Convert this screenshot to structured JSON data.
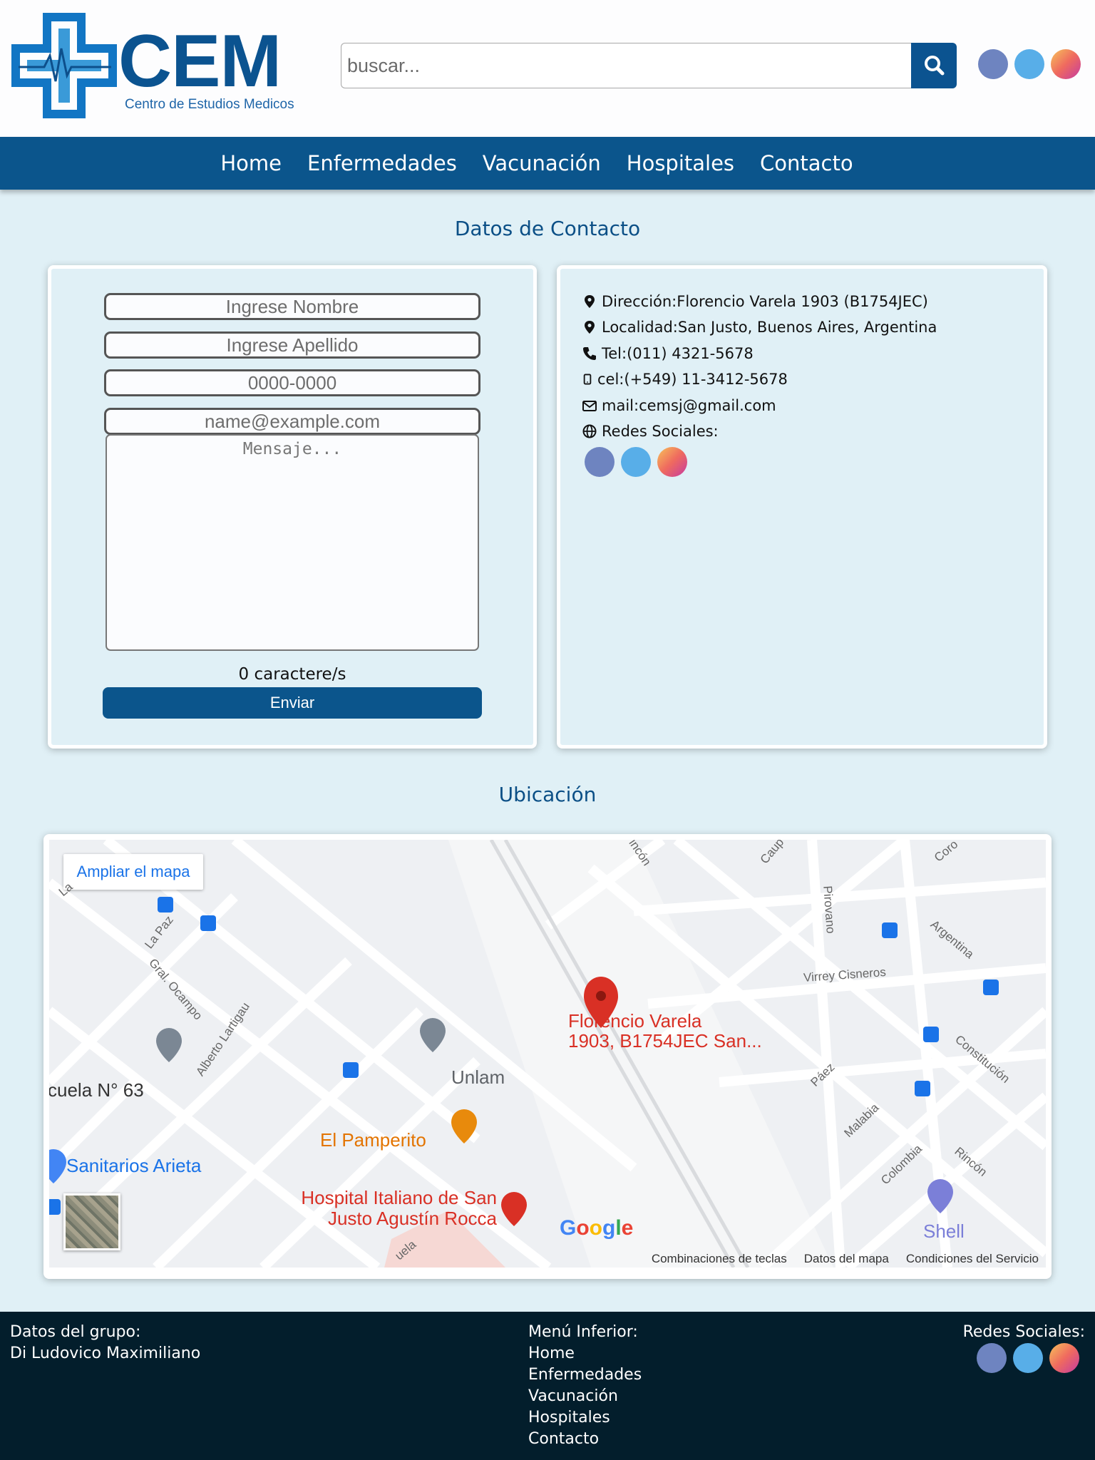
{
  "brand": {
    "name": "CEM",
    "subtitle": "Centro de Estudios Medicos",
    "color": "#0b5390"
  },
  "search": {
    "placeholder": "buscar..."
  },
  "social_icons": [
    "facebook-icon",
    "twitter-icon",
    "instagram-icon"
  ],
  "nav": {
    "items": [
      "Home",
      "Enfermedades",
      "Vacunación",
      "Hospitales",
      "Contacto"
    ]
  },
  "contact": {
    "title": "Datos de Contacto",
    "form": {
      "name_placeholder": "Ingrese Nombre",
      "lastname_placeholder": "Ingrese Apellido",
      "phone_placeholder": "0000-0000",
      "email_placeholder": "name@example.com",
      "message_placeholder": "Mensaje...",
      "char_count": "0 caractere/s",
      "submit_label": "Enviar"
    },
    "info": {
      "address": "Dirección:Florencio Varela 1903 (B1754JEC)",
      "locality": "Localidad:San Justo, Buenos Aires, Argentina",
      "phone": "Tel:(011) 4321-5678",
      "cell": "cel:(+549) 11-3412-5678",
      "mail": "mail:cemsj@gmail.com",
      "social": "Redes Sociales:"
    }
  },
  "location": {
    "title": "Ubicación",
    "map": {
      "expand_label": "Ampliar el mapa",
      "pin_line1": "Florencio Varela",
      "pin_line2": "1903, B1754JEC San...",
      "poi_unlam": "Unlam",
      "poi_pamperito": "El Pamperito",
      "poi_escuela": "cuela N° 63",
      "poi_sanitarios": "Sanitarios Arieta",
      "poi_hospital_1": "Hospital Italiano de San",
      "poi_hospital_2": "Justo Agustín Rocca",
      "poi_shell": "Shell",
      "streets": {
        "la_paz": "La Paz",
        "ocampo": "Gral. Ocampo",
        "lartigau": "Alberto Lartigau",
        "pirovano": "Pirovano",
        "cisneros": "Virrey Cisneros",
        "argentina": "Argentina",
        "constitucion": "Constitución",
        "paez": "Páez",
        "malabia": "Malabia",
        "colombia": "Colombia",
        "rincon": "Rincón",
        "rincon_top": "incón",
        "caupo": "Caup",
        "coro": "Coro",
        "escuela": "uela",
        "la_top": "La"
      },
      "google": "Google",
      "footer_links": [
        "Combinaciones de teclas",
        "Datos del mapa",
        "Condiciones del Servicio"
      ]
    }
  },
  "footer": {
    "group_title": "Datos del grupo:",
    "group_member": "Di Ludovico Maximiliano",
    "menu_title": "Menú Inferior:",
    "menu_items": [
      "Home",
      "Enfermedades",
      "Vacunación",
      "Hospitales",
      "Contacto"
    ],
    "social_title": "Redes Sociales:"
  },
  "colors": {
    "primary": "#0b558c",
    "background": "#e0f0f6",
    "footer": "#031e2c",
    "map_pin": "#d93025"
  }
}
